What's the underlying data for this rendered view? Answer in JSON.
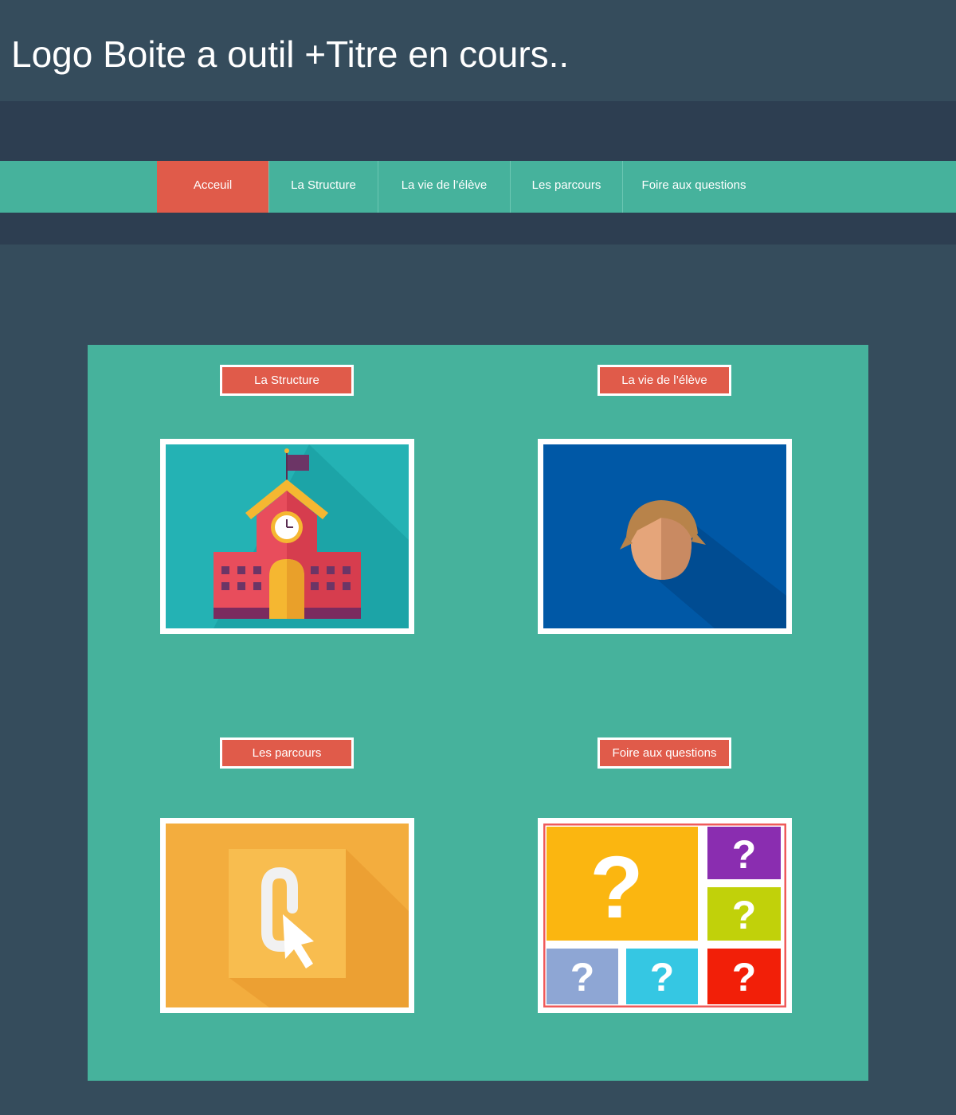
{
  "header": {
    "title": "Logo Boite a outil +Titre en cours.."
  },
  "nav": {
    "items": [
      {
        "label": "Acceuil",
        "active": true
      },
      {
        "label": "La Structure",
        "active": false
      },
      {
        "label": "La vie de l’élève",
        "active": false
      },
      {
        "label": "Les parcours",
        "active": false
      },
      {
        "label": "Foire aux questions",
        "active": false
      }
    ]
  },
  "tiles": [
    {
      "label": "La Structure",
      "icon": "school-building-icon"
    },
    {
      "label": "La vie de l’élève",
      "icon": "student-face-icon"
    },
    {
      "label": "Les parcours",
      "icon": "link-cursor-icon"
    },
    {
      "label": "Foire aux questions",
      "icon": "question-marks-icon"
    }
  ],
  "colors": {
    "page_background": "#354c5c",
    "dark_band": "#2d3e51",
    "teal": "#46b29c",
    "accent_red": "#e05b4a",
    "white": "#ffffff"
  }
}
